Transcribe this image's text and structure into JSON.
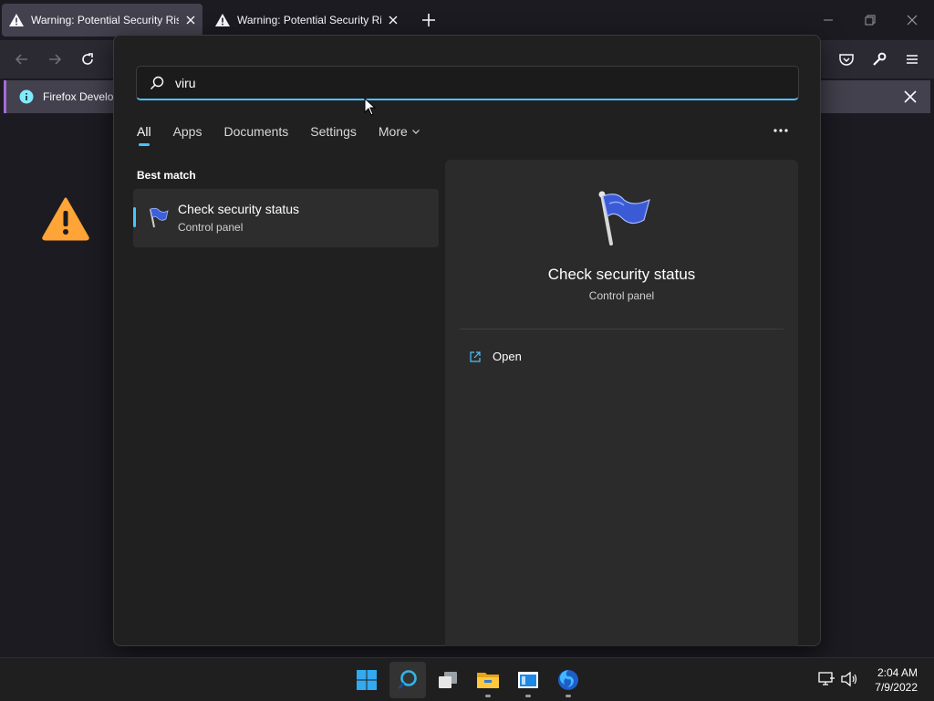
{
  "browser": {
    "tabs": [
      {
        "title": "Warning: Potential Security Risk"
      },
      {
        "title": "Warning: Potential Security Risk"
      }
    ],
    "notice": "Firefox Developer"
  },
  "search": {
    "query": "viru",
    "filters": [
      "All",
      "Apps",
      "Documents",
      "Settings",
      "More"
    ],
    "best_match_label": "Best match",
    "result": {
      "title": "Check security status",
      "subtitle": "Control panel"
    },
    "detail": {
      "title": "Check security status",
      "subtitle": "Control panel",
      "action": "Open"
    }
  },
  "taskbar": {
    "time": "2:04 AM",
    "date": "7/9/2022"
  },
  "colors": {
    "accent": "#4cc2ff",
    "panel": "#202020",
    "firefox_bg": "#1c1b22"
  }
}
